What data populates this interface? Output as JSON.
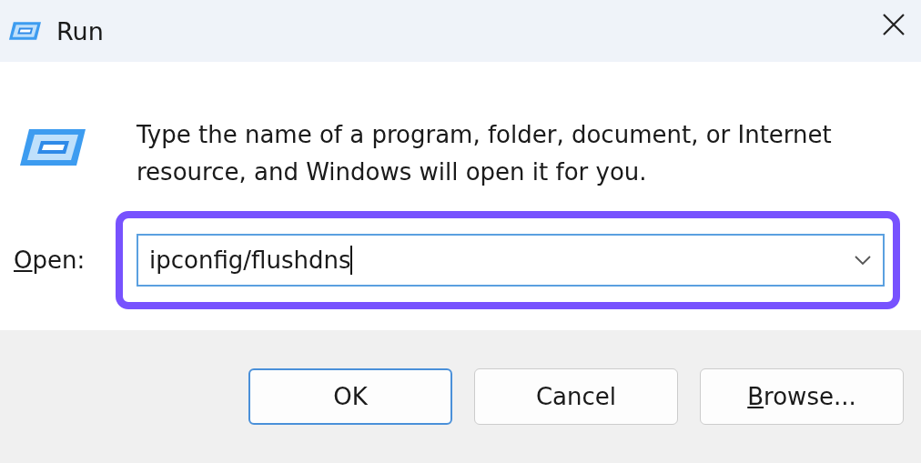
{
  "window": {
    "title": "Run"
  },
  "message": "Type the name of a program, folder, document, or Internet resource, and Windows will open it for you.",
  "open_field": {
    "label_mnemonic": "O",
    "label_rest": "pen:",
    "value": "ipconfig/flushdns",
    "highlighted": true
  },
  "buttons": [
    {
      "label": "OK",
      "default": true
    },
    {
      "label": "Cancel",
      "default": false
    },
    {
      "mnemonic": "B",
      "label": "rowse...",
      "default": false
    }
  ]
}
